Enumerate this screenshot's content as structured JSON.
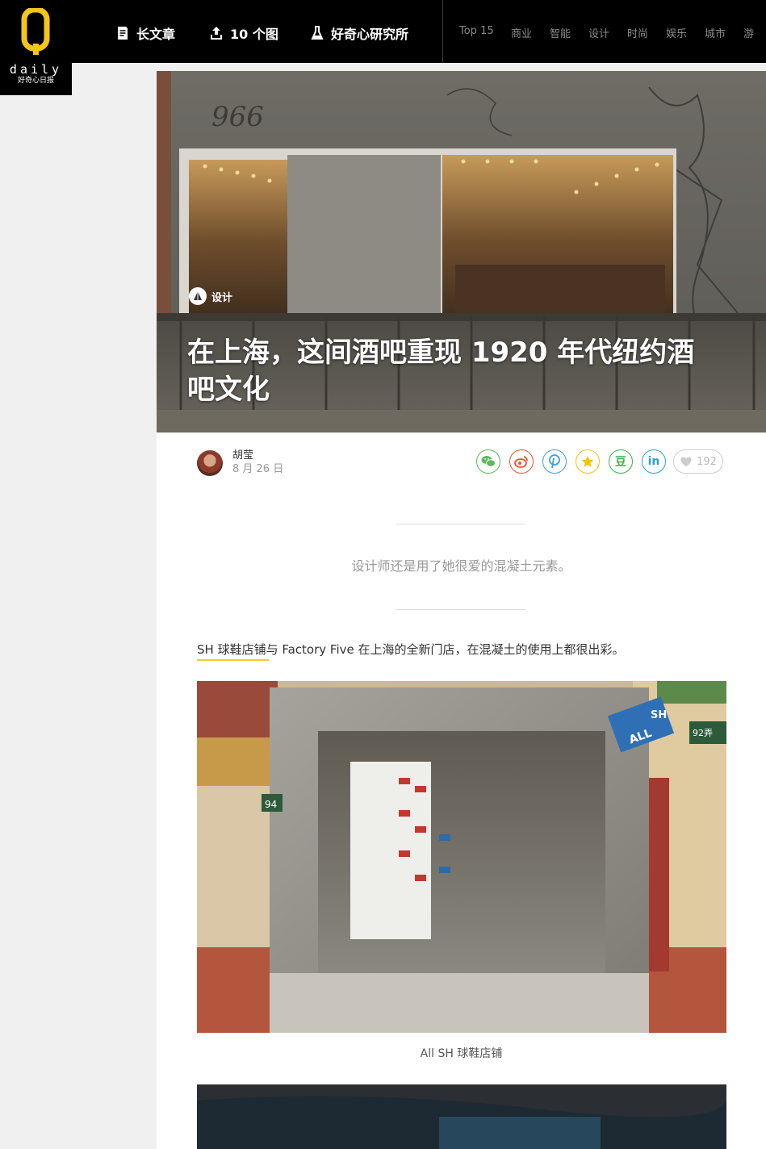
{
  "brand": {
    "logo_letter": "Q",
    "wordmark": "daily",
    "tagline": "好奇心日报"
  },
  "nav": {
    "main": [
      {
        "label": "长文章",
        "icon": "document-icon"
      },
      {
        "label": "10 个图",
        "icon": "upload-icon"
      },
      {
        "label": "好奇心研究所",
        "icon": "flask-icon"
      }
    ],
    "categories": [
      "Top 15",
      "商业",
      "智能",
      "设计",
      "时尚",
      "娱乐",
      "城市",
      "游"
    ]
  },
  "article": {
    "category": "设计",
    "title": "在上海，这间酒吧重现 1920 年代纽约酒吧文化",
    "author": "胡莹",
    "date": "8 月 26 日",
    "likes": "192",
    "summary": "设计师还是用了她很爱的混凝土元素。",
    "lead_link": "SH 球鞋店铺",
    "lead_rest": "与 Factory Five 在上海的全新门店，在混凝土的使用上都很出彩。",
    "image_caption": "All SH 球鞋店铺"
  },
  "hero_photo_text": {
    "wall_sign": "966"
  },
  "storefront_photo_text": {
    "sign_blue": "ALL",
    "sign_sh": "SH",
    "house_number": "94",
    "lane_number": "92弄"
  },
  "share": [
    {
      "name": "wechat",
      "icon": "wechat-icon",
      "color": "#5cb85c",
      "glyph": ""
    },
    {
      "name": "weibo",
      "icon": "weibo-icon",
      "color": "#e8572c",
      "glyph": ""
    },
    {
      "name": "pinterest",
      "icon": "pinterest-icon",
      "color": "#3aa0e0",
      "glyph": ""
    },
    {
      "name": "favorite",
      "icon": "star-icon",
      "color": "#f1c40f",
      "glyph": ""
    },
    {
      "name": "douban",
      "icon": "douban-icon",
      "color": "#3bb34a",
      "glyph": "豆"
    },
    {
      "name": "linkedin",
      "icon": "linkedin-icon",
      "color": "#2d9fd9",
      "glyph": "in"
    }
  ],
  "colors": {
    "accent": "#f6c92a",
    "topbar": "#000000",
    "page_bg": "#f0f0f0"
  }
}
